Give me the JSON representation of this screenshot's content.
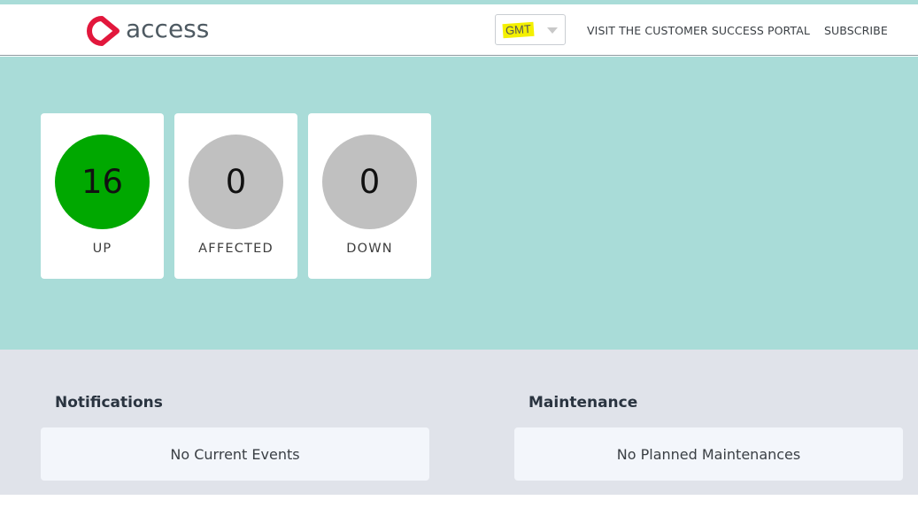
{
  "header": {
    "logo_text": "access",
    "brand_color": "#e2173c",
    "timezone": {
      "selected": "GMT"
    },
    "nav": {
      "portal_label": "VISIT THE CUSTOMER SUCCESS PORTAL",
      "subscribe_label": "SUBSCRIBE"
    }
  },
  "status": {
    "up": {
      "count": "16",
      "label": "UP",
      "color": "#00a800"
    },
    "affected": {
      "count": "0",
      "label": "AFFECTED",
      "color": "#c0c0c0"
    },
    "down": {
      "count": "0",
      "label": "DOWN",
      "color": "#c0c0c0"
    }
  },
  "notifications": {
    "title": "Notifications",
    "empty_text": "No Current Events"
  },
  "maintenance": {
    "title": "Maintenance",
    "empty_text": "No Planned Maintenances"
  },
  "colors": {
    "hero_bg": "#a9dcd8",
    "lower_bg": "#e0e3ea",
    "panel_bg": "#f3f6fb"
  }
}
